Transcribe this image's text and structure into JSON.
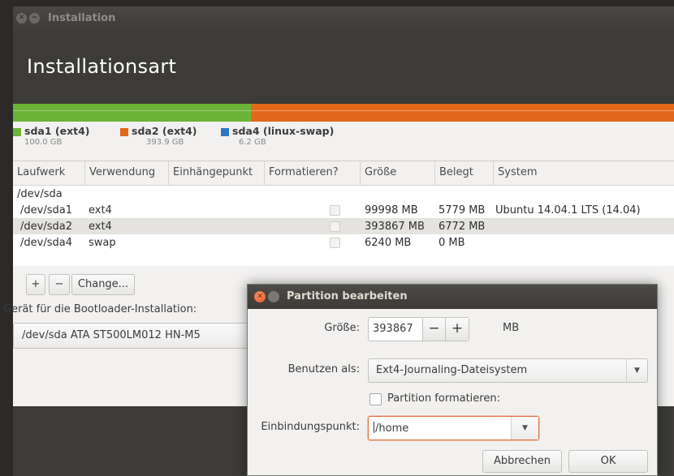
{
  "window": {
    "title": "Installation",
    "page_title": "Installationsart"
  },
  "partition_bar": {
    "segments": [
      {
        "name": "sda1 (ext4)",
        "size": "100.0 GB",
        "color": "#6bb337",
        "fraction": 0.25
      },
      {
        "name": "sda2 (ext4)",
        "size": "393.9 GB",
        "color": "#e3671b",
        "fraction": 0.75
      },
      {
        "name": "sda4 (linux-swap)",
        "size": "6.2 GB",
        "color": "#2a78c4",
        "fraction": 0.0
      }
    ]
  },
  "table": {
    "columns": [
      "Laufwerk",
      "Verwendung",
      "Einhängepunkt",
      "Formatieren?",
      "Größe",
      "Belegt",
      "System"
    ],
    "group": "/dev/sda",
    "rows": [
      {
        "device": "/dev/sda1",
        "use": "ext4",
        "mount": "",
        "size": "99998 MB",
        "used": "5779 MB",
        "system": "Ubuntu 14.04.1 LTS (14.04)"
      },
      {
        "device": "/dev/sda2",
        "use": "ext4",
        "mount": "",
        "size": "393867 MB",
        "used": "6772 MB",
        "system": ""
      },
      {
        "device": "/dev/sda4",
        "use": "swap",
        "mount": "",
        "size": "6240 MB",
        "used": "0 MB",
        "system": ""
      }
    ],
    "selected_row": 1
  },
  "toolbar": {
    "add_label": "+",
    "remove_label": "−",
    "change_label": "Change..."
  },
  "bootloader": {
    "label": "Gerät für die Bootloader-Installation:",
    "value": "/dev/sda   ATA ST500LM012 HN-M5"
  },
  "dialog": {
    "title": "Partition bearbeiten",
    "size_label": "Größe:",
    "size_value": "393867",
    "size_minus": "−",
    "size_plus": "+",
    "size_unit": "MB",
    "use_as_label": "Benutzen als:",
    "use_as_value": "Ext4-Journaling-Dateisystem",
    "format_label": "Partition formatieren:",
    "format_checked": false,
    "mount_label": "Einbindungspunkt:",
    "mount_value": "/home",
    "cancel_label": "Abbrechen",
    "ok_label": "OK"
  }
}
